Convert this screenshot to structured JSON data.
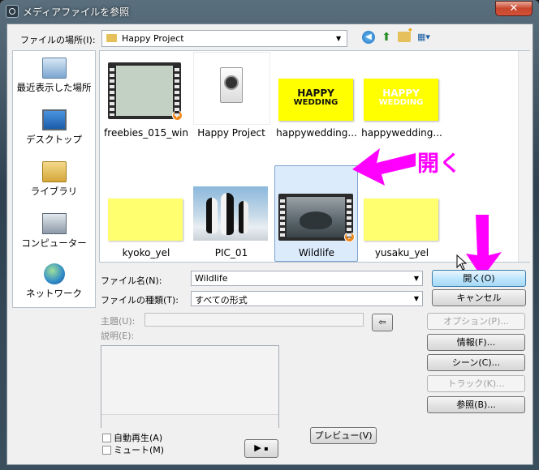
{
  "window": {
    "title": "メディアファイルを参照",
    "close_glyph": "✕"
  },
  "location": {
    "label": "ファイルの場所(I):",
    "value": "Happy Project"
  },
  "places": [
    {
      "label": "最近表示した場所",
      "icon": "recent-places-icon"
    },
    {
      "label": "デスクトップ",
      "icon": "desktop-icon"
    },
    {
      "label": "ライブラリ",
      "icon": "library-icon"
    },
    {
      "label": "コンピューター",
      "icon": "computer-icon"
    },
    {
      "label": "ネットワーク",
      "icon": "network-icon"
    }
  ],
  "files": [
    {
      "name": "freebies_015_win",
      "kind": "video"
    },
    {
      "name": "Happy Project",
      "kind": "project"
    },
    {
      "name": "happywedding...",
      "kind": "image",
      "caption_lines": [
        "HAPPY",
        "WEDDING"
      ]
    },
    {
      "name": "happywedding...",
      "kind": "image",
      "caption_lines": [
        "HAPPY",
        "WEDDING"
      ]
    },
    {
      "name": "kyoko_yel",
      "kind": "image"
    },
    {
      "name": "PIC_01",
      "kind": "photo"
    },
    {
      "name": "Wildlife",
      "kind": "video",
      "selected": true
    },
    {
      "name": "yusaku_yel",
      "kind": "image"
    }
  ],
  "annotation": {
    "text": "開く",
    "color": "#ff00ff"
  },
  "form": {
    "filename_label": "ファイル名(N):",
    "filename_value": "Wildlife",
    "filetype_label": "ファイルの種類(T):",
    "filetype_value": "すべての形式",
    "subject_label": "主題(U):",
    "description_label": "説明(E):",
    "autoplay_label": "自動再生(A)",
    "mute_label": "ミュート(M)"
  },
  "buttons": {
    "open": "開く(O)",
    "cancel": "キャンセル",
    "options": "オプション(P)...",
    "info": "情報(F)...",
    "scene": "シーン(C)...",
    "track": "トラック(K)...",
    "browse": "参照(B)...",
    "preview": "プレビュー(V)",
    "play_glyph": "▶"
  }
}
